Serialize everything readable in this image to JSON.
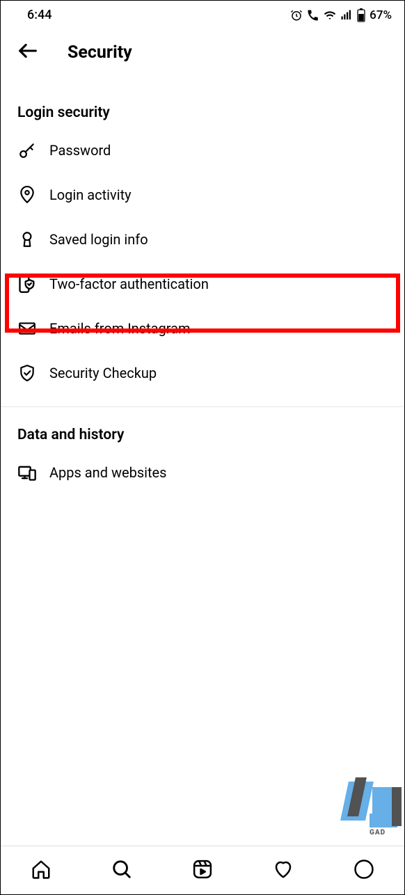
{
  "statusBar": {
    "time": "6:44",
    "batteryText": "67%"
  },
  "header": {
    "title": "Security"
  },
  "sections": {
    "loginSecurity": {
      "title": "Login security",
      "items": {
        "password": "Password",
        "loginActivity": "Login activity",
        "savedLoginInfo": "Saved login info",
        "twoFactor": "Two-factor authentication",
        "emailsFromInstagram": "Emails from Instagram",
        "securityCheckup": "Security Checkup"
      }
    },
    "dataHistory": {
      "title": "Data and history",
      "items": {
        "appsWebsites": "Apps and websites"
      }
    }
  },
  "watermark": {
    "text": "GAD"
  }
}
